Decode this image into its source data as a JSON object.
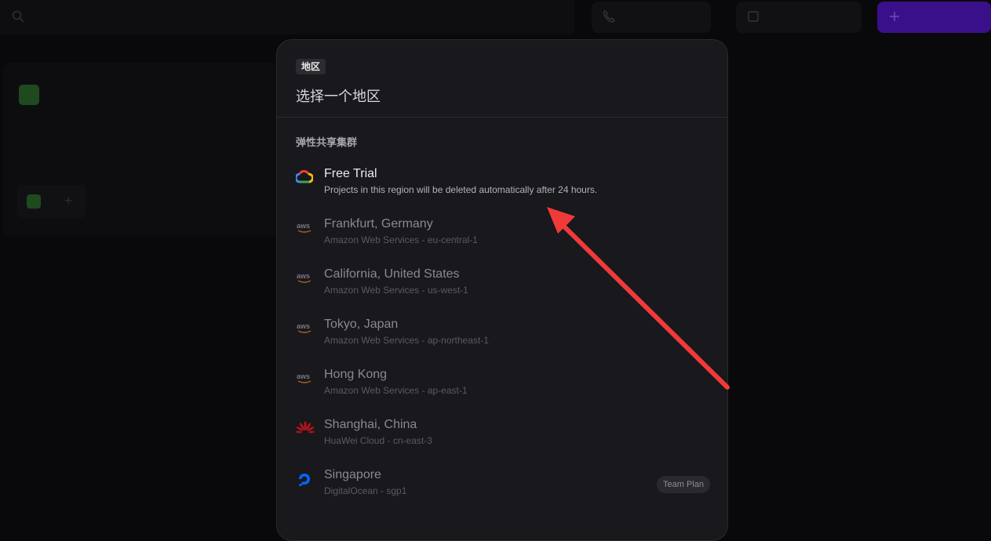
{
  "background": {
    "search_placeholder": "",
    "buttons": [
      {
        "label": "",
        "icon": "phone-icon"
      },
      {
        "label": "",
        "icon": "square-icon"
      },
      {
        "label": "",
        "icon": "plus-icon"
      }
    ],
    "project_name": "",
    "stats": [
      "",
      "",
      "",
      ""
    ]
  },
  "modal": {
    "tag": "地区",
    "title": "选择一个地区",
    "section": "弹性共享集群",
    "regions": [
      {
        "name": "Free Trial",
        "sub": "Projects in this region will be deleted automatically after 24 hours.",
        "logo": "google-cloud-icon"
      },
      {
        "name": "Frankfurt, Germany",
        "sub": "Amazon Web Services - eu-central-1",
        "logo": "aws-icon"
      },
      {
        "name": "California, United States",
        "sub": "Amazon Web Services - us-west-1",
        "logo": "aws-icon"
      },
      {
        "name": "Tokyo, Japan",
        "sub": "Amazon Web Services - ap-northeast-1",
        "logo": "aws-icon"
      },
      {
        "name": "Hong Kong",
        "sub": "Amazon Web Services - ap-east-1",
        "logo": "aws-icon"
      },
      {
        "name": "Shanghai, China",
        "sub": "HuaWei Cloud - cn-east-3",
        "logo": "huawei-icon"
      },
      {
        "name": "Singapore",
        "sub": "DigitalOcean - sgp1",
        "logo": "digitalocean-icon",
        "badge": "Team Plan"
      }
    ]
  },
  "colors": {
    "background": "#09090b",
    "modal": "#19181c",
    "annotation_arrow": "#f03a3a",
    "accent": "#5b21d6"
  }
}
